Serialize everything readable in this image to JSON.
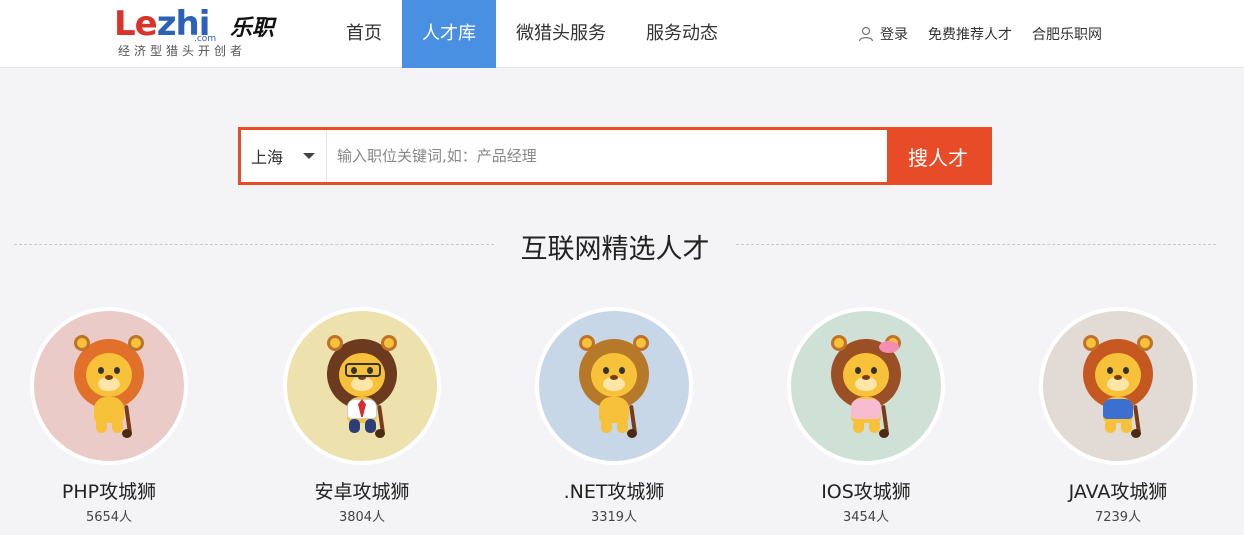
{
  "logo": {
    "wordmark_l": "Le",
    "wordmark_rest": "zhi",
    "cn": "乐职",
    "com": ".com",
    "slogan": "经济型猎头开创者"
  },
  "nav": {
    "items": [
      {
        "label": "首页",
        "active": false
      },
      {
        "label": "人才库",
        "active": true
      },
      {
        "label": "微猎头服务",
        "active": false
      },
      {
        "label": "服务动态",
        "active": false
      }
    ]
  },
  "top_right": {
    "login": "登录",
    "recommend": "免费推荐人才",
    "hefei": "合肥乐职网"
  },
  "search": {
    "city": "上海",
    "placeholder": "输入职位关键词,如：产品经理",
    "button": "搜人才"
  },
  "section": {
    "title": "互联网精选人才"
  },
  "categories": [
    {
      "name": "PHP攻城狮",
      "count": "5654人",
      "bg": "#ebcbc7",
      "mane": "#e0702a",
      "icon": "lion-icon"
    },
    {
      "name": "安卓攻城狮",
      "count": "3804人",
      "bg": "#ede1ad",
      "mane": "#6b3a1f",
      "icon": "lion-glasses-icon"
    },
    {
      "name": ".NET攻城狮",
      "count": "3319人",
      "bg": "#c8d7e8",
      "mane": "#b6792a",
      "icon": "lion-smile-icon"
    },
    {
      "name": "IOS攻城狮",
      "count": "3454人",
      "bg": "#cfe1d6",
      "mane": "#9b4f24",
      "icon": "lioness-bow-icon"
    },
    {
      "name": "JAVA攻城狮",
      "count": "7239人",
      "bg": "#e2dbd5",
      "mane": "#c45820",
      "icon": "lion-blue-shirt-icon"
    }
  ],
  "colors": {
    "accent_blue": "#4a90e2",
    "search_orange": "#e74b28",
    "background": "#f4f4f6"
  }
}
